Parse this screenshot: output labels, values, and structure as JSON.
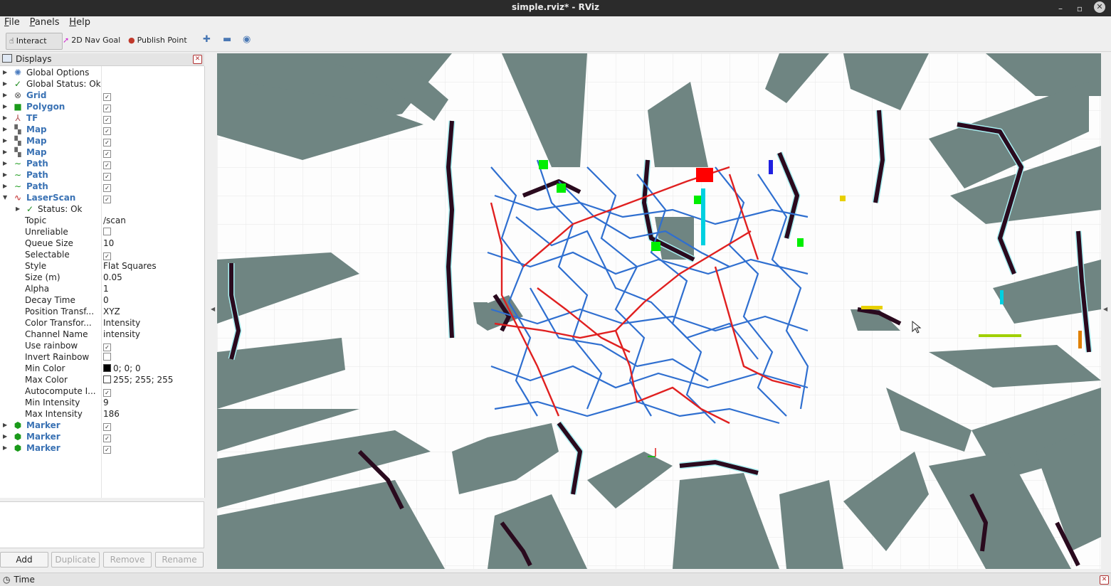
{
  "window": {
    "title": "simple.rviz* - RViz"
  },
  "menu": [
    "File",
    "Panels",
    "Help"
  ],
  "toolbar": {
    "interact": "Interact",
    "nav_goal": "2D Nav Goal",
    "publish_point": "Publish Point"
  },
  "displays_panel": {
    "title": "Displays",
    "items": [
      {
        "name": "Global Options",
        "icon": "globe-icon"
      },
      {
        "name": "Global Status: Ok",
        "icon": "check-icon"
      },
      {
        "name": "Grid",
        "icon": "grid-icon",
        "checked": true
      },
      {
        "name": "Polygon",
        "icon": "polygon-icon",
        "checked": true
      },
      {
        "name": "TF",
        "icon": "tf-icon",
        "checked": true
      },
      {
        "name": "Map",
        "icon": "map-icon",
        "checked": true
      },
      {
        "name": "Map",
        "icon": "map-icon",
        "checked": true
      },
      {
        "name": "Map",
        "icon": "map-icon",
        "checked": true
      },
      {
        "name": "Path",
        "icon": "path-icon",
        "checked": true
      },
      {
        "name": "Path",
        "icon": "path-icon",
        "checked": true
      },
      {
        "name": "Path",
        "icon": "path-icon",
        "checked": true
      },
      {
        "name": "LaserScan",
        "icon": "laserscan-icon",
        "checked": true
      }
    ],
    "laserscan_status": "Status: Ok",
    "laserscan_props": [
      {
        "name": "Topic",
        "value": "/scan"
      },
      {
        "name": "Unreliable",
        "checked": false
      },
      {
        "name": "Queue Size",
        "value": "10"
      },
      {
        "name": "Selectable",
        "checked": true
      },
      {
        "name": "Style",
        "value": "Flat Squares"
      },
      {
        "name": "Size (m)",
        "value": "0.05"
      },
      {
        "name": "Alpha",
        "value": "1"
      },
      {
        "name": "Decay Time",
        "value": "0"
      },
      {
        "name": "Position Transf...",
        "value": "XYZ"
      },
      {
        "name": "Color Transfor...",
        "value": "Intensity"
      },
      {
        "name": "Channel Name",
        "value": "intensity"
      },
      {
        "name": "Use rainbow",
        "checked": true
      },
      {
        "name": "Invert Rainbow",
        "checked": false
      },
      {
        "name": "Min Color",
        "value": "0; 0; 0",
        "swatch": "#000000"
      },
      {
        "name": "Max Color",
        "value": "255; 255; 255",
        "swatch": "#ffffff"
      },
      {
        "name": "Autocompute I...",
        "checked": true
      },
      {
        "name": "Min Intensity",
        "value": "9"
      },
      {
        "name": "Max Intensity",
        "value": "186"
      }
    ],
    "markers": [
      {
        "name": "Marker",
        "checked": true
      },
      {
        "name": "Marker",
        "checked": true
      },
      {
        "name": "Marker",
        "checked": true
      }
    ],
    "buttons": {
      "add": "Add",
      "duplicate": "Duplicate",
      "remove": "Remove",
      "rename": "Rename"
    }
  },
  "time_panel": {
    "title": "Time"
  },
  "colors": {
    "map_gray": "#6f8582",
    "obstacle": "#2a0a1e",
    "inflation": "#a7eef0",
    "tree_blue": "#2f6fd0",
    "path_red": "#e02020",
    "marker_green": "#00ee00",
    "goal_red": "#ff0000"
  }
}
